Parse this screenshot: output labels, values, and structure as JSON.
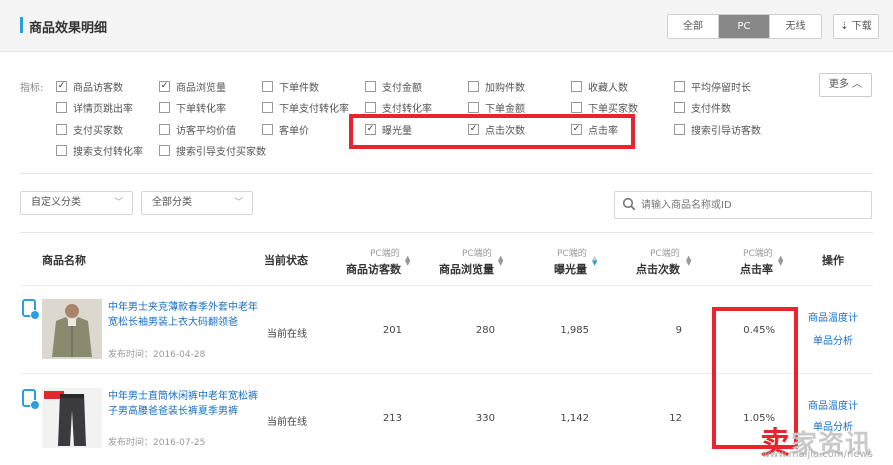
{
  "header": {
    "title": "商品效果明细",
    "tabs": [
      {
        "label": "全部",
        "active": false
      },
      {
        "label": "PC",
        "active": true
      },
      {
        "label": "无线",
        "active": false
      }
    ],
    "download_label": "下载"
  },
  "metrics": {
    "label": "指标:",
    "items": [
      {
        "label": "商品访客数",
        "checked": true
      },
      {
        "label": "商品浏览量",
        "checked": true
      },
      {
        "label": "下单件数",
        "checked": false
      },
      {
        "label": "支付金额",
        "checked": false
      },
      {
        "label": "加购件数",
        "checked": false
      },
      {
        "label": "收藏人数",
        "checked": false
      },
      {
        "label": "平均停留时长",
        "checked": false
      },
      {
        "label": "详情页跳出率",
        "checked": false
      },
      {
        "label": "下单转化率",
        "checked": false
      },
      {
        "label": "下单支付转化率",
        "checked": false
      },
      {
        "label": "支付转化率",
        "checked": false
      },
      {
        "label": "下单金额",
        "checked": false
      },
      {
        "label": "下单买家数",
        "checked": false
      },
      {
        "label": "支付件数",
        "checked": false
      },
      {
        "label": "支付买家数",
        "checked": false
      },
      {
        "label": "访客平均价值",
        "checked": false
      },
      {
        "label": "客单价",
        "checked": false
      },
      {
        "label": "曝光量",
        "checked": true
      },
      {
        "label": "点击次数",
        "checked": true
      },
      {
        "label": "点击率",
        "checked": true
      },
      {
        "label": "搜索引导访客数",
        "checked": false
      },
      {
        "label": "搜索支付转化率",
        "checked": false
      },
      {
        "label": "搜索引导支付买家数",
        "checked": false
      }
    ],
    "more_label": "更多"
  },
  "filters": {
    "category_custom": "自定义分类",
    "category_all": "全部分类",
    "search_placeholder": "请输入商品名称或ID"
  },
  "table": {
    "headers": {
      "name": "商品名称",
      "status": "当前状态",
      "col1_sub": "PC端的",
      "col1": "商品访客数",
      "col2_sub": "PC端的",
      "col2": "商品浏览量",
      "col3_sub": "PC端的",
      "col3": "曝光量",
      "col4_sub": "PC端的",
      "col4": "点击次数",
      "col5_sub": "PC端的",
      "col5": "点击率",
      "ops": "操作"
    },
    "rows": [
      {
        "name": "中年男士夹克薄款春季外套中老年宽松长袖男装上衣大码翻领爸",
        "date": "发布时间：2016-04-28",
        "status": "当前在线",
        "visitors": "201",
        "views": "280",
        "exposure": "1,985",
        "clicks": "9",
        "ctr": "0.45%",
        "op1": "商品温度计",
        "op2": "单品分析"
      },
      {
        "name": "中年男士直筒休闲裤中老年宽松裤子男高腰爸爸装长裤夏季男裤",
        "date": "发布时间：2016-07-25",
        "status": "当前在线",
        "visitors": "213",
        "views": "330",
        "exposure": "1,142",
        "clicks": "12",
        "ctr": "1.05%",
        "op1": "商品温度计",
        "op2": "单品分析"
      }
    ]
  },
  "watermark": {
    "brand": "卖家资讯",
    "url": "www.maijia.com/news"
  }
}
